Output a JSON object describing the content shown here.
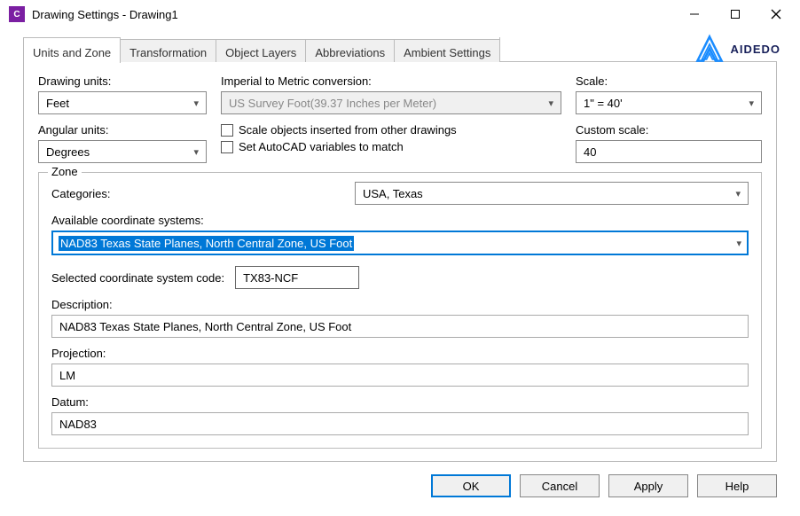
{
  "window": {
    "title": "Drawing Settings - Drawing1",
    "app_icon_letter": "C"
  },
  "brand": "AIDEDO",
  "tabs": {
    "units_zone": "Units and Zone",
    "transformation": "Transformation",
    "object_layers": "Object Layers",
    "abbreviations": "Abbreviations",
    "ambient_settings": "Ambient Settings"
  },
  "units": {
    "drawing_units_label": "Drawing units:",
    "drawing_units_value": "Feet",
    "angular_units_label": "Angular units:",
    "angular_units_value": "Degrees",
    "conversion_label": "Imperial to Metric conversion:",
    "conversion_value": "US Survey Foot(39.37 Inches per Meter)",
    "chk_scale_objects": "Scale objects inserted from other drawings",
    "chk_set_autocad": "Set AutoCAD variables to match",
    "scale_label": "Scale:",
    "scale_value": "1\" = 40'",
    "custom_scale_label": "Custom scale:",
    "custom_scale_value": "40"
  },
  "zone": {
    "legend": "Zone",
    "categories_label": "Categories:",
    "categories_value": "USA, Texas",
    "available_label": "Available coordinate systems:",
    "available_value": "NAD83 Texas State Planes, North Central Zone, US Foot",
    "selected_code_label": "Selected coordinate system code:",
    "selected_code_value": "TX83-NCF",
    "description_label": "Description:",
    "description_value": "NAD83 Texas State Planes, North Central Zone, US Foot",
    "projection_label": "Projection:",
    "projection_value": "LM",
    "datum_label": "Datum:",
    "datum_value": "NAD83"
  },
  "buttons": {
    "ok": "OK",
    "cancel": "Cancel",
    "apply": "Apply",
    "help": "Help"
  }
}
